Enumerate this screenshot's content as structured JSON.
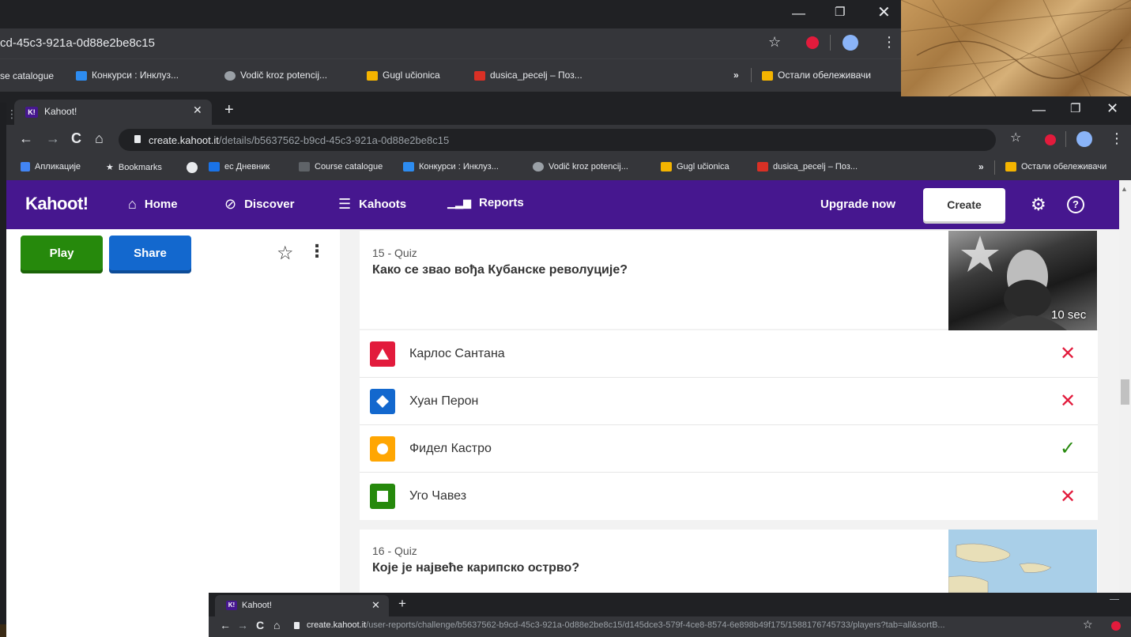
{
  "bg_window": {
    "url": "cd-45c3-921a-0d88e2be8c15",
    "bookmarks": [
      {
        "label": "se catalogue"
      },
      {
        "label": "Конкурси : Инклуз..."
      },
      {
        "label": "Vodič kroz potencij..."
      },
      {
        "label": "Gugl učionica"
      },
      {
        "label": "dusica_pecelj – Поз..."
      }
    ],
    "overflow": "»",
    "other_bookmarks": "Остали обележивачи"
  },
  "main_window": {
    "tab_title": "Kahoot!",
    "tab_favicon": "K!",
    "url_host": "create.kahoot.it",
    "url_path": "/details/b5637562-b9cd-45c3-921a-0d88e2be8c15",
    "bookmarks": [
      {
        "label": "Апликације",
        "icon": "apps-grid-icon"
      },
      {
        "label": "Bookmarks",
        "icon": "star-icon"
      },
      {
        "label": "",
        "icon": "globe-icon"
      },
      {
        "label": "ес Дневник",
        "icon": "ednevnik-icon"
      },
      {
        "label": "Course catalogue",
        "icon": "graduation-cap-icon"
      },
      {
        "label": "Конкурси : Инклуз...",
        "icon": "folder-icon"
      },
      {
        "label": "Vodič kroz potencij...",
        "icon": "guide-icon"
      },
      {
        "label": "Gugl učionica",
        "icon": "classroom-icon"
      },
      {
        "label": "dusica_pecelj – Поз...",
        "icon": "gmail-icon"
      }
    ],
    "overflow": "»",
    "other_bookmarks": "Остали обележивачи"
  },
  "kahoot_nav": {
    "logo": "Kahoot!",
    "items": [
      {
        "label": "Home",
        "icon": "house-icon"
      },
      {
        "label": "Discover",
        "icon": "compass-icon"
      },
      {
        "label": "Kahoots",
        "icon": "list-icon"
      },
      {
        "label": "Reports",
        "icon": "bar-chart-icon"
      }
    ],
    "upgrade": "Upgrade now",
    "create": "Create"
  },
  "left_panel": {
    "play": "Play",
    "share": "Share"
  },
  "questions": [
    {
      "number": "15 - Quiz",
      "title": "Како се звао вођа Кубанске револуције?",
      "time": "10 sec",
      "answers": [
        {
          "text": "Карлос Сантана",
          "shape": "triangle",
          "color": "#e21b3c",
          "correct": false
        },
        {
          "text": "Хуан Перон",
          "shape": "diamond",
          "color": "#1368ce",
          "correct": false
        },
        {
          "text": "Фидел Кастро",
          "shape": "circle",
          "color": "#ffa602",
          "correct": true
        },
        {
          "text": "Уго Чавез",
          "shape": "square",
          "color": "#26890c",
          "correct": false
        }
      ]
    },
    {
      "number": "16 - Quiz",
      "title": "Које је највеће карипско острво?"
    }
  ],
  "third_window": {
    "tab_title": "Kahoot!",
    "url_host": "create.kahoot.it",
    "url_path": "/user-reports/challenge/b5637562-b9cd-45c3-921a-0d88e2be8c15/d145dce3-579f-4ce8-8574-6e898b49f175/1588176745733/players?tab=all&sortB..."
  },
  "colors": {
    "kahoot_purple": "#46178f",
    "wrong_red": "#e21b3c",
    "correct_green": "#26890c"
  }
}
